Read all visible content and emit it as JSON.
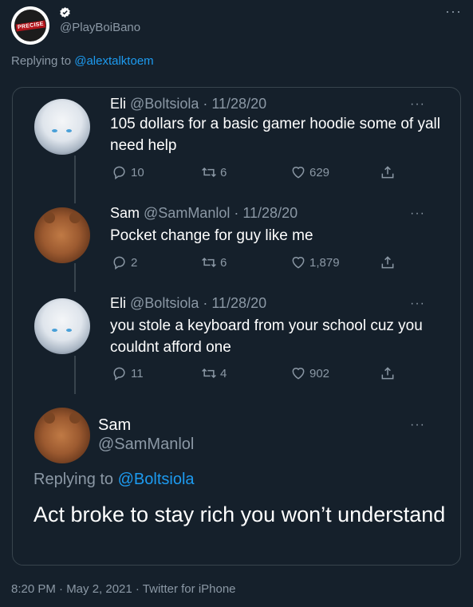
{
  "header": {
    "avatar_text": "PRECISE",
    "handle": "@PlayBoiBano",
    "more": "···"
  },
  "replying": {
    "prefix": "Replying to ",
    "target": "@alextalktoem"
  },
  "thread": [
    {
      "name": "Eli",
      "handle": "@Boltsiola",
      "date": "· 11/28/20",
      "text": "105 dollars for a basic gamer hoodie some of yall need help",
      "replies": "10",
      "retweets": "6",
      "likes": "629"
    },
    {
      "name": "Sam",
      "handle": "@SamManlol",
      "date": "· 11/28/20",
      "text": "Pocket change for guy like me",
      "replies": "2",
      "retweets": "6",
      "likes": "1,879"
    },
    {
      "name": "Eli",
      "handle": "@Boltsiola",
      "date": "· 11/28/20",
      "text": "you stole a keyboard from your school cuz you couldnt afford one",
      "replies": "11",
      "retweets": "4",
      "likes": "902"
    }
  ],
  "final": {
    "name": "Sam",
    "handle": "@SamManlol",
    "replying_prefix": "Replying to ",
    "replying_target": "@Boltsiola",
    "text": "Act broke to stay rich you won’t understand"
  },
  "footer": "8:20 PM · May 2, 2021 · Twitter for iPhone",
  "colors": {
    "background": "#15202b",
    "accent": "#1d9bf0",
    "muted": "#8b98a5",
    "border": "#38444d"
  }
}
